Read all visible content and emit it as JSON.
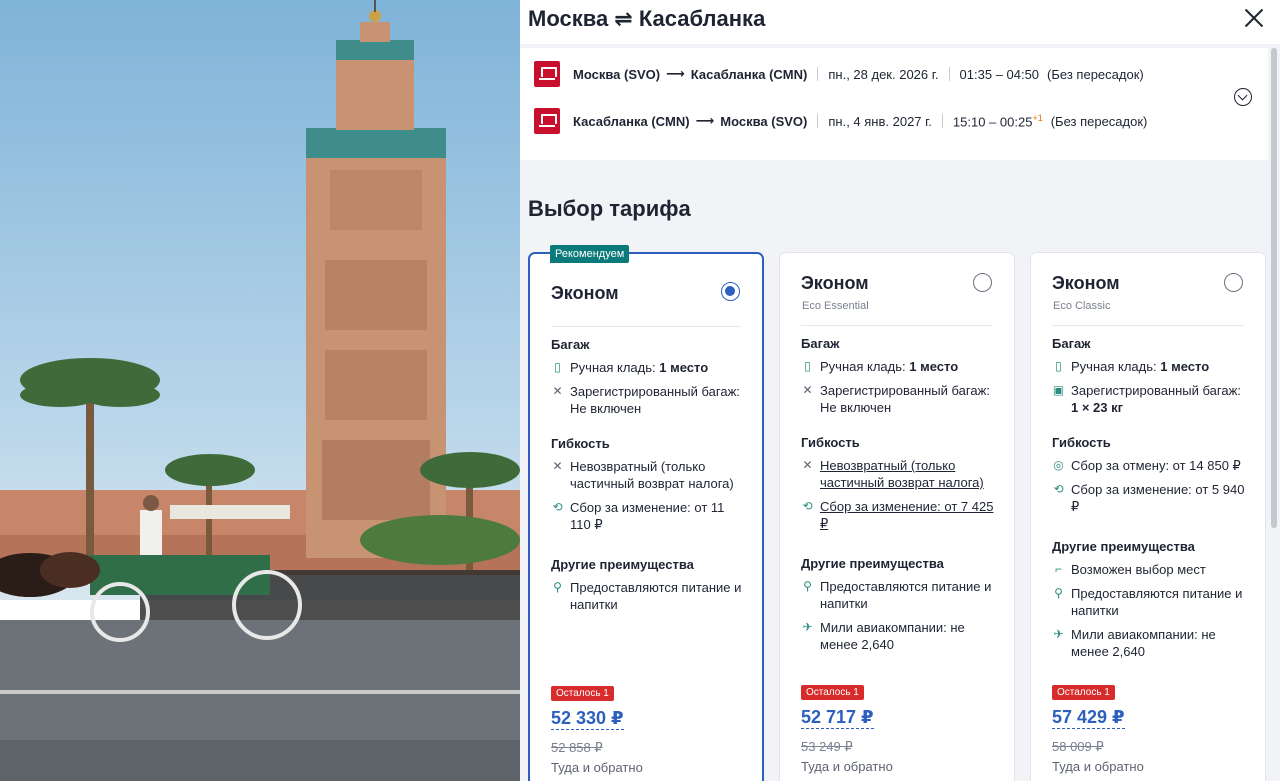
{
  "header": {
    "title": "Москва ⇌ Касабланка"
  },
  "flights": [
    {
      "route_from": "Москва (SVO)",
      "route_to": "Касабланка (CMN)",
      "date": "пн., 28 дек. 2026 г.",
      "time": "01:35 – 04:50",
      "time_suffix": "",
      "stops": "(Без пересадок)"
    },
    {
      "route_from": "Касабланка (CMN)",
      "route_to": "Москва (SVO)",
      "date": "пн., 4 янв. 2027 г.",
      "time": "15:10 – 00:25",
      "time_suffix": "+1",
      "stops": "(Без пересадок)"
    }
  ],
  "section_title": "Выбор тарифа",
  "fares": [
    {
      "badge": "Рекомендуем",
      "name": "Эконом",
      "subtitle": "",
      "selected": true,
      "baggage_title": "Багаж",
      "carry_on_label": "Ручная кладь:",
      "carry_on_value": "1 место",
      "checked_label": "Зарегистрированный багаж:",
      "checked_value": "Не включен",
      "flex_title": "Гибкость",
      "refund": "Невозвратный (только частичный возврат налога)",
      "change": "Сбор за изменение: от 11 110 ₽",
      "other_title": "Другие преимущества",
      "other": [
        "Предоставляются питание и напитки"
      ],
      "left_badge": "Осталось 1",
      "price": "52 330 ₽",
      "old_price": "52 858 ₽",
      "trip": "Туда и обратно"
    },
    {
      "badge": "",
      "name": "Эконом",
      "subtitle": "Eco Essential",
      "selected": false,
      "baggage_title": "Багаж",
      "carry_on_label": "Ручная кладь:",
      "carry_on_value": "1 место",
      "checked_label": "Зарегистрированный багаж:",
      "checked_value": "Не включен",
      "flex_title": "Гибкость",
      "refund": "Невозвратный (только частичный возврат налога)",
      "change": "Сбор за изменение: от 7 425 ₽",
      "other_title": "Другие преимущества",
      "other": [
        "Предоставляются питание и напитки",
        "Мили авиакомпании: не менее 2,640"
      ],
      "left_badge": "Осталось 1",
      "price": "52 717 ₽",
      "old_price": "53 249 ₽",
      "trip": "Туда и обратно"
    },
    {
      "badge": "",
      "name": "Эконом",
      "subtitle": "Eco Classic",
      "selected": false,
      "baggage_title": "Багаж",
      "carry_on_label": "Ручная кладь:",
      "carry_on_value": "1 место",
      "checked_label": "Зарегистрированный багаж:",
      "checked_value": "1 × 23 кг",
      "flex_title": "Гибкость",
      "cancel": "Сбор за отмену: от 14 850 ₽",
      "change": "Сбор за изменение: от 5 940 ₽",
      "other_title": "Другие преимущества",
      "other": [
        "Возможен выбор мест",
        "Предоставляются питание и напитки",
        "Мили авиакомпании: не менее 2,640"
      ],
      "left_badge": "Осталось 1",
      "price": "57 429 ₽",
      "old_price": "58 009 ₽",
      "trip": "Туда и обратно"
    }
  ],
  "colors": {
    "accent": "#2d5fbf",
    "badge_teal": "#0a7a7a",
    "badge_red": "#d82c2c",
    "airline_red": "#c8102e"
  }
}
